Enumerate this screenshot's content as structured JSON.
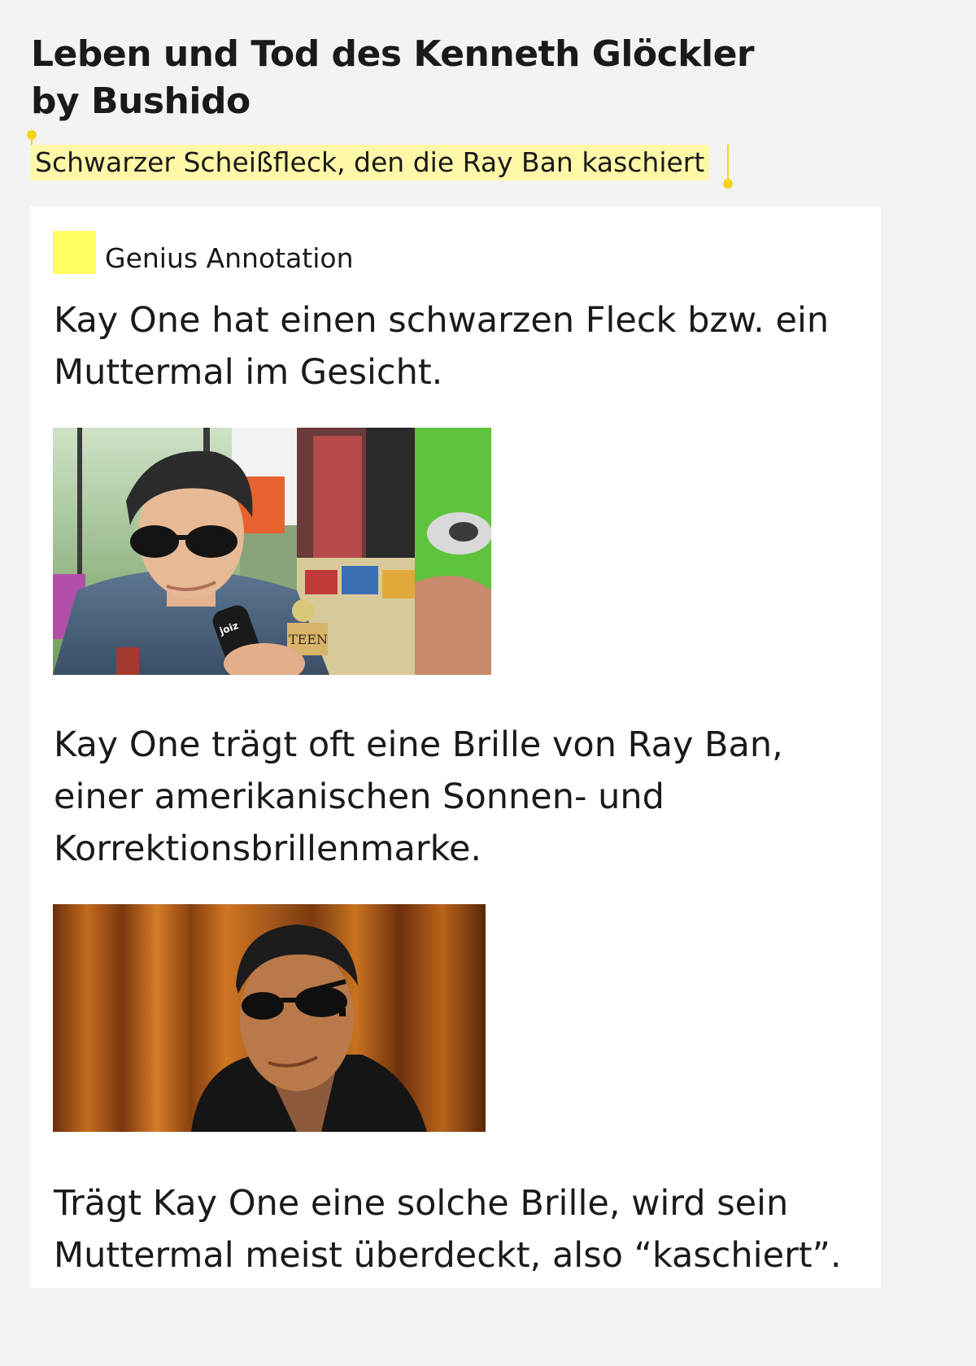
{
  "song": {
    "title_line1": "Leben und Tod des Kenneth Glöckler",
    "title_line2": "by Bushido"
  },
  "lyric": {
    "highlighted_text": "Schwarzer Scheißfleck, den die Ray Ban kaschiert"
  },
  "annotation": {
    "label": "Genius Annotation",
    "accent_color": "#ffff64",
    "highlight_color": "#fff8a8",
    "paragraph1": [
      "Kay One hat einen schwarzen Fleck bzw. ein",
      "Muttermal im Gesicht."
    ],
    "paragraph2": [
      "Kay One trägt oft eine Brille von Ray Ban,",
      "einer amerikanischen Sonnen- und",
      "Korrektionsbrillenmarke."
    ],
    "paragraph3": [
      "Trägt Kay One eine solche Brille, wird sein",
      "Muttermal meist überdeckt, also “kaschiert”."
    ]
  },
  "photos": {
    "photo1": {
      "mic_text": "joiz",
      "patch_text": "TEEN"
    }
  }
}
